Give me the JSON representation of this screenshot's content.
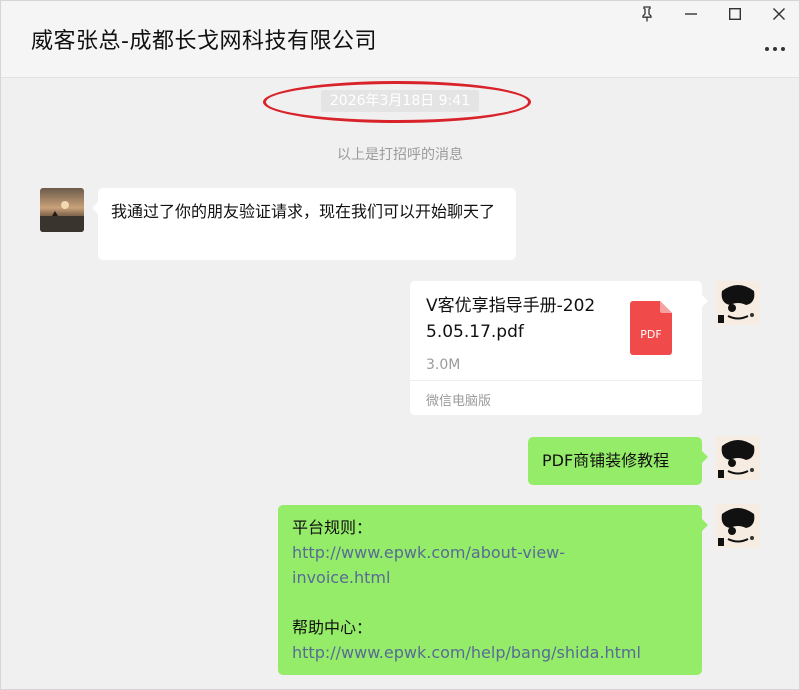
{
  "window": {
    "title": "威客张总-成都长戈网科技有限公司",
    "controls": {
      "pin": "pin-icon",
      "minimize": "minimize-icon",
      "maximize": "maximize-icon",
      "close": "close-icon",
      "more": "more-icon"
    }
  },
  "chat": {
    "timestamp": "2026年3月18日 9:41",
    "system_message": "以上是打招呼的消息",
    "messages": [
      {
        "side": "left",
        "type": "text",
        "text": "我通过了你的朋友验证请求，现在我们可以开始聊天了"
      },
      {
        "side": "right",
        "type": "file",
        "file_name": "V客优享指导手册-2025.05.17.pdf",
        "file_size": "3.0M",
        "source": "微信电脑版",
        "file_icon_label": "PDF"
      },
      {
        "side": "right",
        "type": "text",
        "text": "PDF商铺装修教程"
      },
      {
        "side": "right",
        "type": "text",
        "lines": {
          "rules_label": "平台规则：",
          "rules_link_1": "http://www.epwk.com/about-view-",
          "rules_link_2": "invoice.html",
          "help_label": "帮助中心：",
          "help_link": "http://www.epwk.com/help/bang/shida.html"
        }
      }
    ]
  },
  "colors": {
    "green_bubble": "#95ec69",
    "white_bubble": "#ffffff",
    "link": "#576b95",
    "highlight_circle": "#d8232a",
    "pdf_red": "#f04a4a"
  }
}
